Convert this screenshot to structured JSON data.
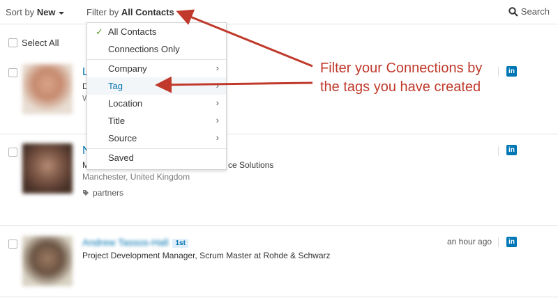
{
  "toolbar": {
    "sort_prefix": "Sort by",
    "sort_value": "New",
    "filter_prefix": "Filter by",
    "filter_value": "All Contacts",
    "search_label": "Search"
  },
  "select_all_label": "Select All",
  "filter_menu": {
    "items": [
      {
        "label": "All Contacts",
        "checked": true
      },
      {
        "label": "Connections Only"
      },
      {
        "label": "Company",
        "submenu": true
      },
      {
        "label": "Tag",
        "submenu": true,
        "highlighted": true
      },
      {
        "label": "Location",
        "submenu": true
      },
      {
        "label": "Title",
        "submenu": true
      },
      {
        "label": "Source",
        "submenu": true
      },
      {
        "label": "Saved"
      }
    ]
  },
  "contacts": [
    {
      "name_visible": "L",
      "line1": "D",
      "line2": "W",
      "linkedin_icon": "in"
    },
    {
      "name_visible": "N",
      "line1_start": "M",
      "line1_end": "ce Solutions",
      "location": "Manchester, United Kingdom",
      "tag": "partners",
      "linkedin_icon": "in"
    },
    {
      "name_blurred": "Andrew Tassos-Hall",
      "degree": "1st",
      "headline": "Project Development Manager, Scrum Master at Rohde & Schwarz",
      "time": "an hour ago",
      "linkedin_icon": "in"
    }
  ],
  "annotation": {
    "line1": "Filter your Connections by",
    "line2": "the tags you have created",
    "color": "#c0392b"
  },
  "colors": {
    "link": "#0073b1",
    "linkedin": "#0077b5",
    "check": "#5a9e2f"
  }
}
